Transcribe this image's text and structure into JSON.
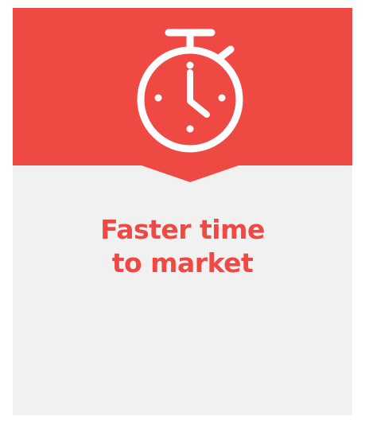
{
  "card": {
    "icon": "stopwatch-icon",
    "title_line1": "Faster time",
    "title_line2": "to market"
  },
  "colors": {
    "accent": "#ef4944",
    "card_background": "#f1f1f1",
    "icon_color": "#ffffff"
  }
}
